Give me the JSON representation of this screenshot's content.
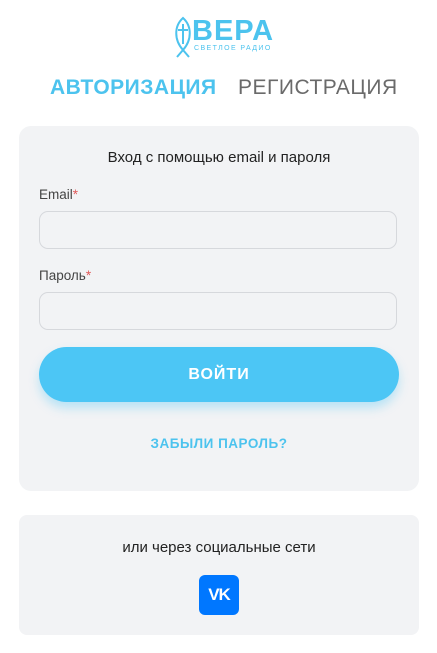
{
  "logo": {
    "word": "ВЕРА",
    "tagline": "светлое радио",
    "accent": "#4cc3ee"
  },
  "tabs": [
    {
      "label": "АВТОРИЗАЦИЯ",
      "active": true
    },
    {
      "label": "РЕГИСТРАЦИЯ",
      "active": false
    }
  ],
  "login": {
    "title": "Вход с помощью email и пароля",
    "email_label": "Email",
    "email_value": "",
    "password_label": "Пароль",
    "password_value": "",
    "required_mark": "*",
    "submit_label": "ВОЙТИ",
    "forgot_label": "ЗАБЫЛИ ПАРОЛЬ?"
  },
  "social": {
    "title": "или через социальные сети",
    "vk_label": "VK",
    "vk_icon": "vk-icon"
  },
  "colors": {
    "accent": "#4cc3ee",
    "button": "#4cc6f5",
    "vk": "#0077ff",
    "required": "#e05a5a"
  }
}
